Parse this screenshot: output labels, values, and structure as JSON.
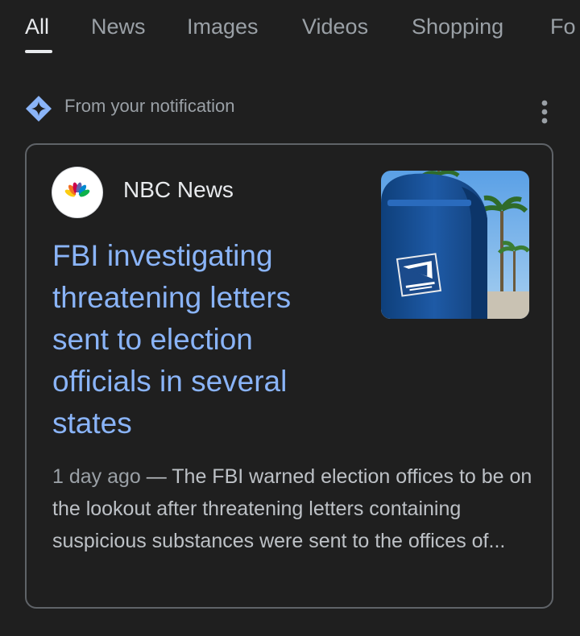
{
  "tabs": [
    {
      "label": "All",
      "active": true
    },
    {
      "label": "News",
      "active": false
    },
    {
      "label": "Images",
      "active": false
    },
    {
      "label": "Videos",
      "active": false
    },
    {
      "label": "Shopping",
      "active": false
    },
    {
      "label": "Fo",
      "active": false
    }
  ],
  "notification": {
    "label": "From your notification",
    "icon": "sparkle-diamond-icon",
    "menu_icon": "more-vert-icon"
  },
  "article": {
    "source": "NBC News",
    "source_logo": "nbc-peacock-logo",
    "headline": "FBI investigating threatening letters sent to election officials in several states",
    "date": "1 day ago",
    "separator": " — ",
    "snippet": "The FBI warned election offices to be on the lookout after threatening letters containing suspicious substances were sent to the offices of...",
    "thumbnail": "usps-mailbox-photo"
  },
  "colors": {
    "background": "#1f1f1f",
    "link": "#8ab4f8",
    "text_primary": "#e8eaed",
    "text_secondary": "#9aa0a6",
    "snippet_text": "#bdc1c6",
    "card_border": "#5f6368",
    "accent_icon": "#8ab4f8"
  }
}
